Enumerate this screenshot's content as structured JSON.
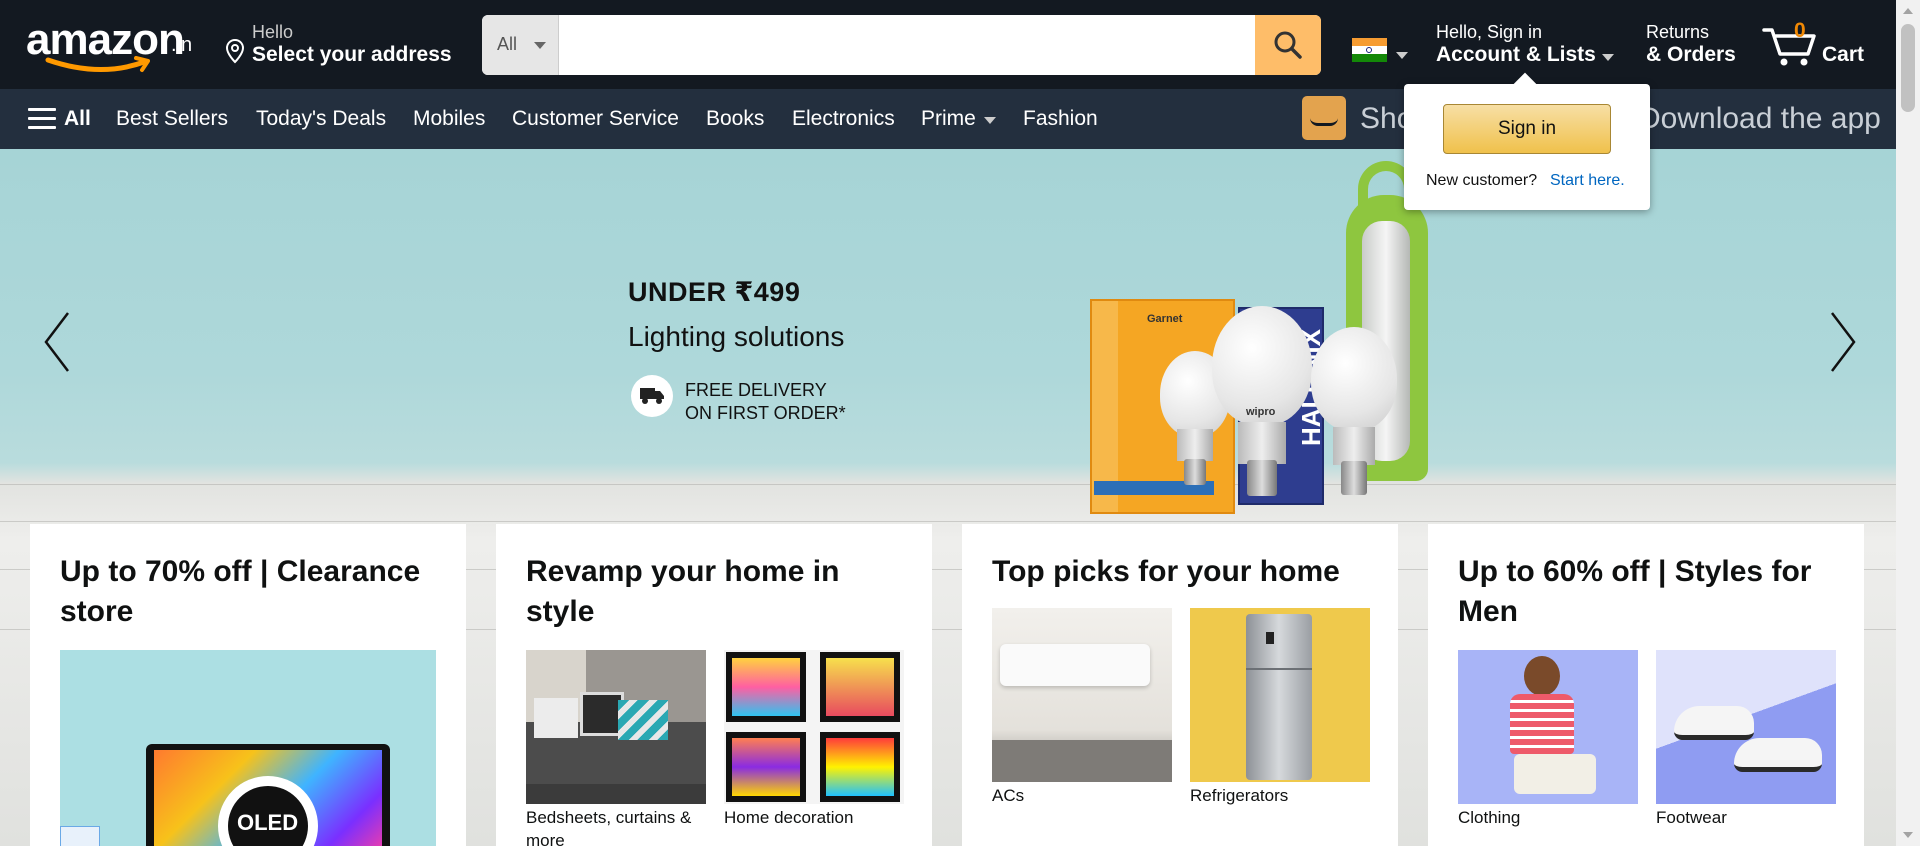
{
  "header": {
    "logo": "amazon",
    "logo_suffix": ".in",
    "address_line1": "Hello",
    "address_line2": "Select your address",
    "search": {
      "category": "All",
      "value": "",
      "placeholder": ""
    },
    "account_line1": "Hello, Sign in",
    "account_line2": "Account & Lists",
    "returns_line1": "Returns",
    "returns_line2": "& Orders",
    "cart_count": "0",
    "cart_label": "Cart",
    "icons": [
      "location-pin-icon",
      "search-icon",
      "india-flag-icon",
      "cart-icon"
    ]
  },
  "subnav": {
    "all_label": "All",
    "links": [
      "Best Sellers",
      "Today's Deals",
      "Mobiles",
      "Customer Service",
      "Books",
      "Electronics",
      "Prime",
      "Fashion"
    ],
    "promo_left": "Sho",
    "promo_right": "Download the app"
  },
  "popover": {
    "sign_in_label": "Sign in",
    "new_customer": "New customer?",
    "start_here": "Start here."
  },
  "hero": {
    "headline": "UNDER ₹499",
    "subheadline": "Lighting solutions",
    "delivery_line1": "FREE DELIVERY",
    "delivery_line2": "ON FIRST ORDER*",
    "product_brands": [
      "Garnet",
      "wipro",
      "wipro",
      "HALONIX"
    ]
  },
  "cards": [
    {
      "title": "Up to 70% off | Clearance store",
      "tiles": [
        {
          "label": "",
          "image_text": "OLED"
        }
      ]
    },
    {
      "title": "Revamp your home in style",
      "tiles": [
        {
          "label": "Bedsheets, curtains & more"
        },
        {
          "label": "Home decoration"
        }
      ]
    },
    {
      "title": "Top picks for your home",
      "tiles": [
        {
          "label": "ACs"
        },
        {
          "label": "Refrigerators"
        }
      ]
    },
    {
      "title": "Up to 60% off | Styles for Men",
      "tiles": [
        {
          "label": "Clothing"
        },
        {
          "label": "Footwear"
        }
      ]
    }
  ],
  "colors": {
    "nav_dark": "#131921",
    "nav_sub": "#232f3e",
    "search_button": "#febd69",
    "cart_count": "#f08804",
    "link_blue": "#0066c0"
  }
}
